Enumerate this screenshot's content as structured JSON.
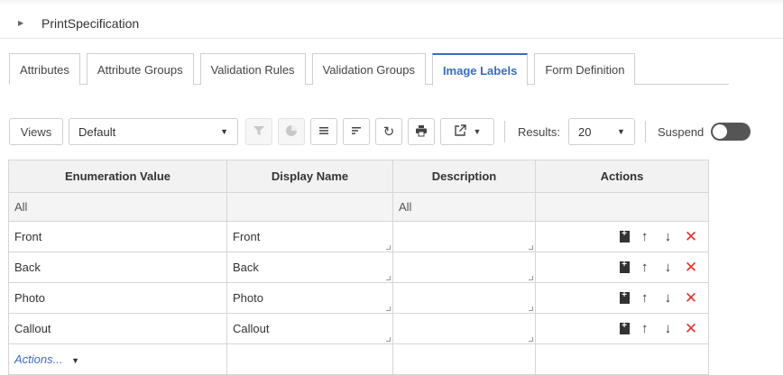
{
  "header": {
    "title": "PrintSpecification"
  },
  "tabs": [
    {
      "label": "Attributes"
    },
    {
      "label": "Attribute Groups"
    },
    {
      "label": "Validation Rules"
    },
    {
      "label": "Validation Groups"
    },
    {
      "label": "Image Labels",
      "active": true
    },
    {
      "label": "Form Definition"
    }
  ],
  "toolbar": {
    "views_label": "Views",
    "view_selected": "Default",
    "results_label": "Results:",
    "results_value": "20",
    "suspend_label": "Suspend"
  },
  "grid": {
    "columns": [
      "Enumeration Value",
      "Display Name",
      "Description",
      "Actions"
    ],
    "filter": [
      "All",
      "",
      "All",
      ""
    ],
    "rows": [
      {
        "value": "Front",
        "display": "Front",
        "description": ""
      },
      {
        "value": "Back",
        "display": "Back",
        "description": ""
      },
      {
        "value": "Photo",
        "display": "Photo",
        "description": ""
      },
      {
        "value": "Callout",
        "display": "Callout",
        "description": ""
      }
    ],
    "footer_actions": "Actions..."
  },
  "colors": {
    "accent": "#3a6bc4",
    "delete": "#e0312b"
  }
}
